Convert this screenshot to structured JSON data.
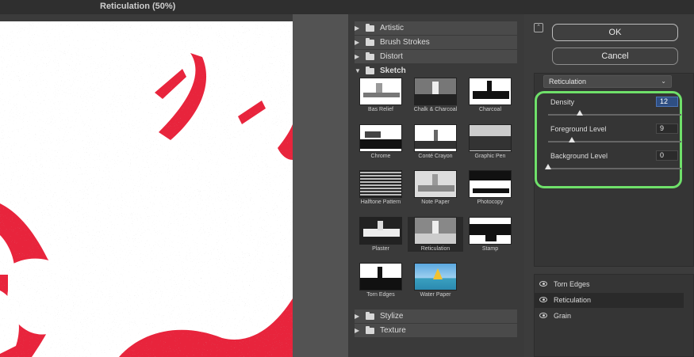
{
  "window": {
    "title": "Reticulation (50%)"
  },
  "gallery": {
    "categories_top": [
      {
        "label": "Artistic"
      },
      {
        "label": "Brush Strokes"
      },
      {
        "label": "Distort"
      },
      {
        "label": "Sketch"
      }
    ],
    "sketch_filters": [
      {
        "label": "Bas Relief"
      },
      {
        "label": "Chalk & Charcoal"
      },
      {
        "label": "Charcoal"
      },
      {
        "label": "Chrome"
      },
      {
        "label": "Conté Crayon"
      },
      {
        "label": "Graphic Pen"
      },
      {
        "label": "Halftone Pattern"
      },
      {
        "label": "Note Paper"
      },
      {
        "label": "Photocopy"
      },
      {
        "label": "Plaster"
      },
      {
        "label": "Reticulation"
      },
      {
        "label": "Stamp"
      },
      {
        "label": "Torn Edges"
      },
      {
        "label": "Water Paper"
      }
    ],
    "selected_filter": "Reticulation",
    "categories_bottom": [
      {
        "label": "Stylize"
      },
      {
        "label": "Texture"
      }
    ]
  },
  "buttons": {
    "ok": "OK",
    "cancel": "Cancel"
  },
  "filter_select": {
    "value": "Reticulation",
    "chevron": "⌄"
  },
  "params": [
    {
      "label": "Density",
      "value": "12",
      "level": 0.24
    },
    {
      "label": "Foreground Level",
      "value": "9",
      "level": 0.18
    },
    {
      "label": "Background Level",
      "value": "0",
      "level": 0.0
    }
  ],
  "layers": [
    {
      "label": "Torn Edges"
    },
    {
      "label": "Reticulation"
    },
    {
      "label": "Grain"
    }
  ],
  "colors": {
    "accent_highlight": "#6fe06a",
    "preview_red": "#e8243c",
    "selected_value_bg": "#2f4f83"
  },
  "icons": {
    "expand": "triangle-right-icon",
    "collapse": "triangle-down-icon",
    "folder": "folder-icon",
    "eye": "eye-icon"
  }
}
